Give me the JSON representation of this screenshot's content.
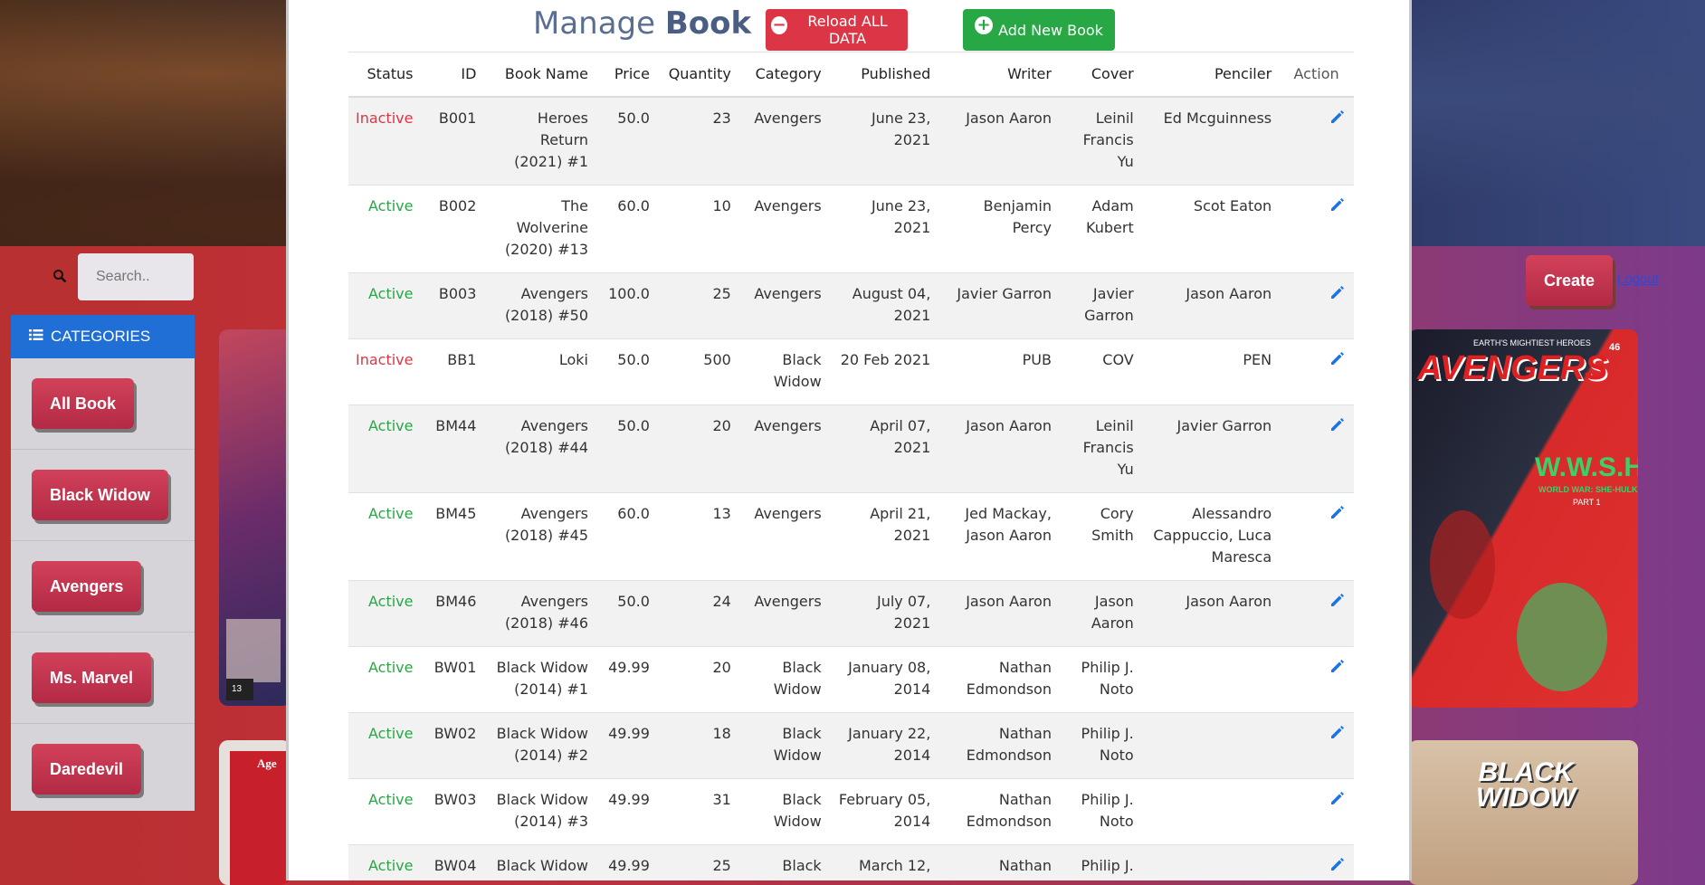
{
  "search": {
    "placeholder": "Search.."
  },
  "categories": {
    "header": "CATEGORIES",
    "items": [
      {
        "label": "All Book"
      },
      {
        "label": "Black Widow"
      },
      {
        "label": "Avengers"
      },
      {
        "label": "Ms. Marvel"
      },
      {
        "label": "Daredevil"
      }
    ]
  },
  "header_actions": {
    "create_label": "Create",
    "logout_label": "Logout"
  },
  "modal": {
    "title_prefix": "Manage",
    "title_bold": "Book",
    "reload_label": "Reload ALL DATA",
    "add_label": "Add New Book"
  },
  "table": {
    "columns": [
      "Status",
      "ID",
      "Book Name",
      "Price",
      "Quantity",
      "Category",
      "Published",
      "Writer",
      "Cover",
      "Penciler",
      "Action"
    ],
    "rows": [
      {
        "status": "Inactive",
        "id": "B001",
        "name": "Heroes Return (2021) #1",
        "price": "50.0",
        "quantity": "23",
        "category": "Avengers",
        "published": "June 23, 2021",
        "writer": "Jason Aaron",
        "cover": "Leinil Francis Yu",
        "penciler": "Ed Mcguinness"
      },
      {
        "status": "Active",
        "id": "B002",
        "name": "The Wolverine (2020) #13",
        "price": "60.0",
        "quantity": "10",
        "category": "Avengers",
        "published": "June 23, 2021",
        "writer": "Benjamin Percy",
        "cover": "Adam Kubert",
        "penciler": "Scot Eaton"
      },
      {
        "status": "Active",
        "id": "B003",
        "name": "Avengers (2018) #50",
        "price": "100.0",
        "quantity": "25",
        "category": "Avengers",
        "published": "August 04, 2021",
        "writer": "Javier Garron",
        "cover": "Javier Garron",
        "penciler": "Jason Aaron"
      },
      {
        "status": "Inactive",
        "id": "BB1",
        "name": "Loki",
        "price": "50.0",
        "quantity": "500",
        "category": "Black Widow",
        "published": "20 Feb 2021",
        "writer": "PUB",
        "cover": "COV",
        "penciler": "PEN"
      },
      {
        "status": "Active",
        "id": "BM44",
        "name": "Avengers (2018) #44",
        "price": "50.0",
        "quantity": "20",
        "category": "Avengers",
        "published": "April 07, 2021",
        "writer": "Jason Aaron",
        "cover": "Leinil Francis Yu",
        "penciler": "Javier Garron"
      },
      {
        "status": "Active",
        "id": "BM45",
        "name": "Avengers (2018) #45",
        "price": "60.0",
        "quantity": "13",
        "category": "Avengers",
        "published": "April 21, 2021",
        "writer": "Jed Mackay, Jason Aaron",
        "cover": "Cory Smith",
        "penciler": "Alessandro Cappuccio, Luca Maresca"
      },
      {
        "status": "Active",
        "id": "BM46",
        "name": "Avengers (2018) #46",
        "price": "50.0",
        "quantity": "24",
        "category": "Avengers",
        "published": "July 07, 2021",
        "writer": "Jason Aaron",
        "cover": "Jason Aaron",
        "penciler": "Jason Aaron"
      },
      {
        "status": "Active",
        "id": "BW01",
        "name": "Black Widow (2014) #1",
        "price": "49.99",
        "quantity": "20",
        "category": "Black Widow",
        "published": "January 08, 2014",
        "writer": "Nathan Edmondson",
        "cover": "Philip J. Noto",
        "penciler": ""
      },
      {
        "status": "Active",
        "id": "BW02",
        "name": "Black Widow (2014) #2",
        "price": "49.99",
        "quantity": "18",
        "category": "Black Widow",
        "published": "January 22, 2014",
        "writer": "Nathan Edmondson",
        "cover": "Philip J. Noto",
        "penciler": ""
      },
      {
        "status": "Active",
        "id": "BW03",
        "name": "Black Widow (2014) #3",
        "price": "49.99",
        "quantity": "31",
        "category": "Black Widow",
        "published": "February 05, 2014",
        "writer": "Nathan Edmondson",
        "cover": "Philip J. Noto",
        "penciler": ""
      },
      {
        "status": "Active",
        "id": "BW04",
        "name": "Black Widow",
        "price": "49.99",
        "quantity": "25",
        "category": "Black",
        "published": "March 12,",
        "writer": "Nathan",
        "cover": "Philip J.",
        "penciler": ""
      }
    ]
  },
  "comics": {
    "right_top_title": "AVENGERS",
    "right_top_tagline": "EARTH'S MIGHTIEST HEROES",
    "right_top_issue": "46",
    "right_top_subtitle": "W.W.S.H.",
    "right_top_sub2": "WORLD WAR: SHE-HULK",
    "right_top_part": "PART 1",
    "right_bottom_title": "BLACK WIDOW",
    "left_issue": "13",
    "left_bottom_title": "Age"
  },
  "colors": {
    "active": "#28a745",
    "inactive": "#dc3545",
    "reload": "#dc3545",
    "add": "#28a745",
    "categories_header": "#1f6fd6",
    "category_button": "#c2304a"
  }
}
